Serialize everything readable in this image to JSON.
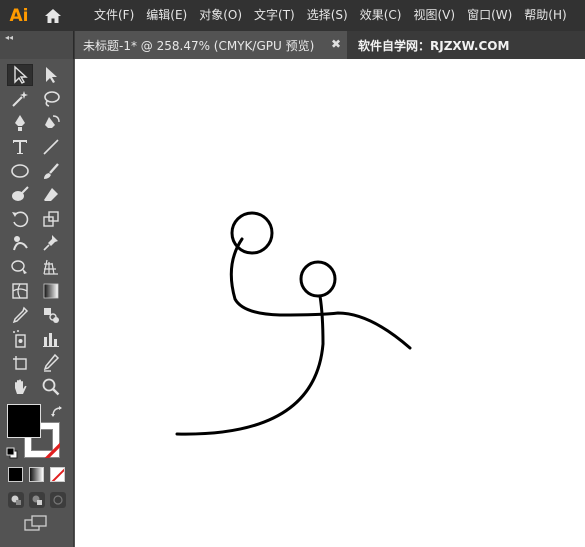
{
  "app": {
    "logo": "Ai"
  },
  "menus": [
    "文件(F)",
    "编辑(E)",
    "对象(O)",
    "文字(T)",
    "选择(S)",
    "效果(C)",
    "视图(V)",
    "窗口(W)",
    "帮助(H)"
  ],
  "tabs": {
    "collapse_label": "◂◂",
    "document": "未标题-1* @ 258.47% (CMYK/GPU 预览)",
    "close": "✖",
    "site": "软件自学网：RJZXW.COM"
  },
  "toolbar": {
    "tools": [
      "selection-tool",
      "direct-selection-tool",
      "magic-wand-tool",
      "lasso-tool",
      "pen-tool",
      "curvature-tool",
      "type-tool",
      "line-segment-tool",
      "ellipse-tool",
      "paintbrush-tool",
      "shaper-tool",
      "eraser-tool",
      "rotate-tool",
      "scale-tool",
      "puppet-warp-tool",
      "pin-tool",
      "shape-builder-tool",
      "perspective-grid-tool",
      "mesh-tool",
      "gradient-tool",
      "eyedropper-tool",
      "blend-tool",
      "symbol-sprayer-tool",
      "column-graph-tool",
      "artboard-tool",
      "slice-tool",
      "hand-tool",
      "zoom-tool"
    ],
    "active_tool": "selection-tool",
    "fill_color": "#000000",
    "stroke_color": "none"
  },
  "colors": {
    "accent": "#ff9a00",
    "canvas": "#ffffff",
    "ui_dark": "#323232",
    "ui_mid": "#535353"
  }
}
